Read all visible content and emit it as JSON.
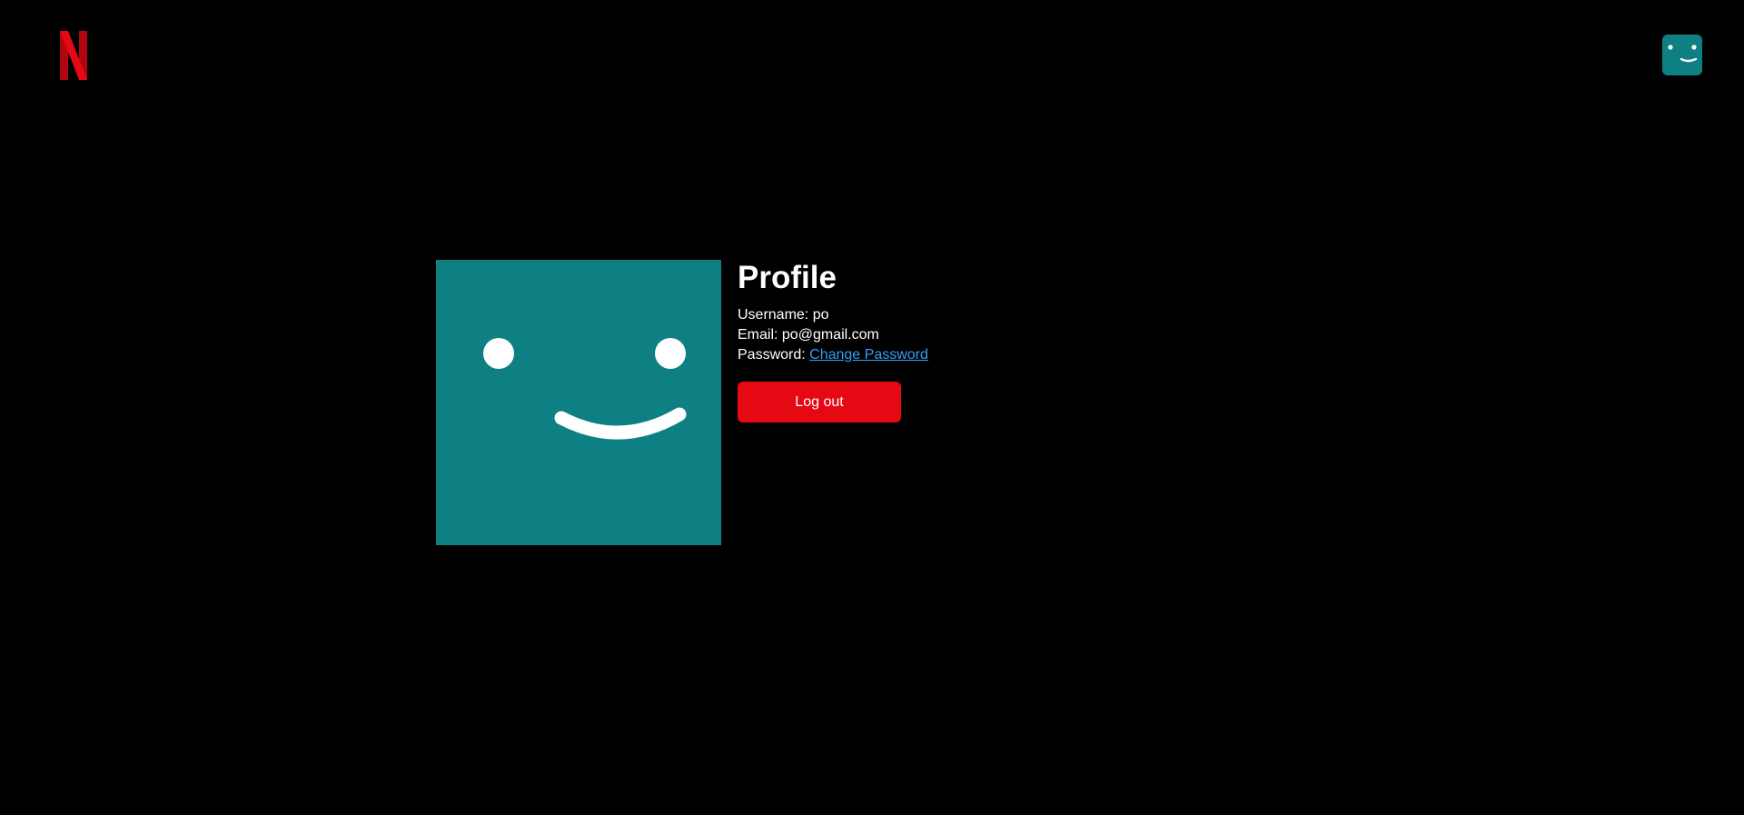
{
  "header": {
    "logo_icon": "netflix-n-logo-icon",
    "avatar_icon": "smiley-face-avatar-icon"
  },
  "profile": {
    "image_icon": "smiley-face-avatar-icon",
    "title": "Profile",
    "username_label": "Username:",
    "username_value": "po",
    "email_label": "Email:",
    "email_value": "po@gmail.com",
    "password_label": "Password:",
    "change_password_link": "Change Password",
    "logout_label": "Log out"
  },
  "colors": {
    "background": "#000000",
    "brand_red": "#e50914",
    "avatar_teal": "#0e7f82",
    "link_blue": "#3b9cf5",
    "text": "#ffffff"
  }
}
